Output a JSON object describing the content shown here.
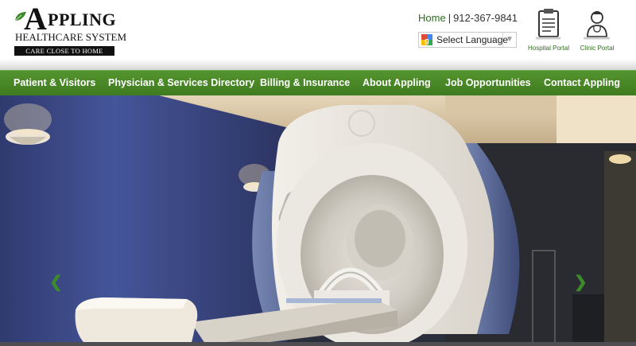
{
  "brand": {
    "logo_initial": "A",
    "logo_word1": "PPLING",
    "logo_word2": "HEALTHCARE SYSTEM",
    "tagline": "CARE CLOSE TO HOME"
  },
  "header": {
    "home_link": "Home",
    "separator": "|",
    "phone": "912-367-9841",
    "language_select": "Select Language",
    "portals": [
      {
        "label": "Hospital Portal",
        "icon": "clipboard-icon"
      },
      {
        "label": "Clinic Portal",
        "icon": "doctor-icon"
      }
    ]
  },
  "nav": {
    "items": [
      "Patient & Visitors",
      "Physician & Services Directory",
      "Billing & Insurance",
      "About Appling",
      "Job Opportunities",
      "Contact Appling"
    ]
  },
  "hero": {
    "image": "mri-scanner-room",
    "prev_icon": "chevron-left-icon",
    "next_icon": "chevron-right-icon",
    "prev_glyph": "❮",
    "next_glyph": "❯"
  },
  "colors": {
    "nav_green": "#4a8a27",
    "link_green": "#2f6d1f",
    "wall_blue": "#3d4a86"
  }
}
